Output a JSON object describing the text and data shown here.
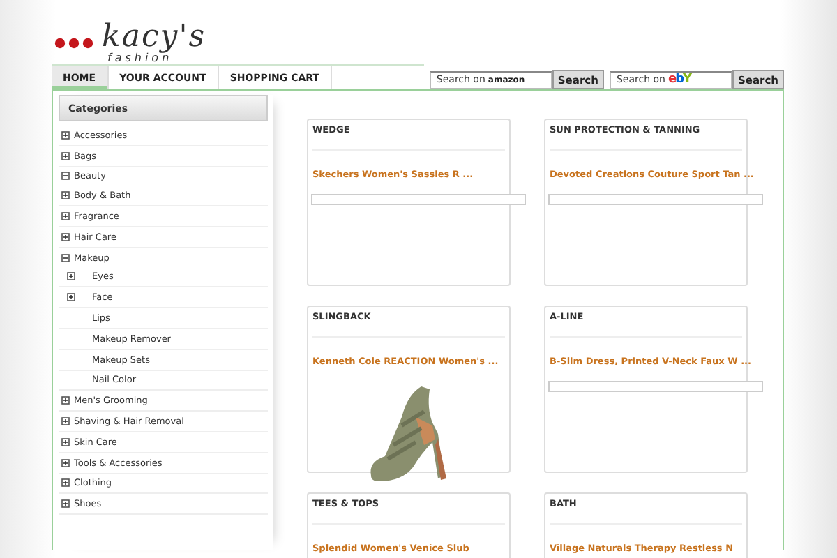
{
  "logo": {
    "name": "kacy's",
    "tagline": "fashion"
  },
  "nav": [
    {
      "label": "HOME",
      "selected": true
    },
    {
      "label": "YOUR ACCOUNT",
      "selected": false
    },
    {
      "label": "SHOPPING CART",
      "selected": false
    }
  ],
  "searches": [
    {
      "placeholder": "Search on",
      "brand": "amazon",
      "kind": "amazon",
      "button": "Search"
    },
    {
      "placeholder": "Search on",
      "brand": "ebY",
      "kind": "ebay",
      "button": "Search"
    }
  ],
  "sidebar": {
    "title": "Categories",
    "items": [
      {
        "label": "Accessories",
        "kind": "node",
        "expanded": false
      },
      {
        "label": "Bags",
        "kind": "node",
        "expanded": false
      },
      {
        "label": "Beauty",
        "kind": "node",
        "expanded": true,
        "children": [
          {
            "label": "Body & Bath",
            "kind": "node",
            "expanded": false
          },
          {
            "label": "Fragrance",
            "kind": "node",
            "expanded": false
          },
          {
            "label": "Hair Care",
            "kind": "node",
            "expanded": false
          },
          {
            "label": "Makeup",
            "kind": "node",
            "expanded": true,
            "children": [
              {
                "label": "Eyes",
                "kind": "node",
                "expanded": false
              },
              {
                "label": "Face",
                "kind": "node",
                "expanded": false
              },
              {
                "label": "Lips",
                "kind": "leaf"
              },
              {
                "label": "Makeup Remover",
                "kind": "leaf"
              },
              {
                "label": "Makeup Sets",
                "kind": "leaf"
              },
              {
                "label": "Nail Color",
                "kind": "leaf"
              }
            ]
          },
          {
            "label": "Men's Grooming",
            "kind": "node",
            "expanded": false
          },
          {
            "label": "Shaving & Hair Removal",
            "kind": "node",
            "expanded": false
          },
          {
            "label": "Skin Care",
            "kind": "node",
            "expanded": false
          },
          {
            "label": "Tools & Accessories",
            "kind": "node",
            "expanded": false
          }
        ]
      },
      {
        "label": "Clothing",
        "kind": "node",
        "expanded": false
      },
      {
        "label": "Shoes",
        "kind": "node",
        "expanded": false
      }
    ]
  },
  "products": [
    {
      "category": "WEDGE",
      "title": "Skechers Women's Sassies R ...",
      "kind": "bar"
    },
    {
      "category": "SUN PROTECTION & TANNING",
      "title": "Devoted Creations Couture Sport Tan ...",
      "kind": "bar"
    },
    {
      "category": "SLINGBACK",
      "title": "Kenneth Cole REACTION Women's ...",
      "kind": "photo"
    },
    {
      "category": "A-LINE",
      "title": "B-Slim Dress, Printed V-Neck Faux W ...",
      "kind": "bar"
    },
    {
      "category": "TEES & TOPS",
      "title": "Splendid Women's Venice Slub",
      "kind": "none"
    },
    {
      "category": "BATH",
      "title": "Village Naturals Therapy Restless N",
      "kind": "none"
    }
  ]
}
